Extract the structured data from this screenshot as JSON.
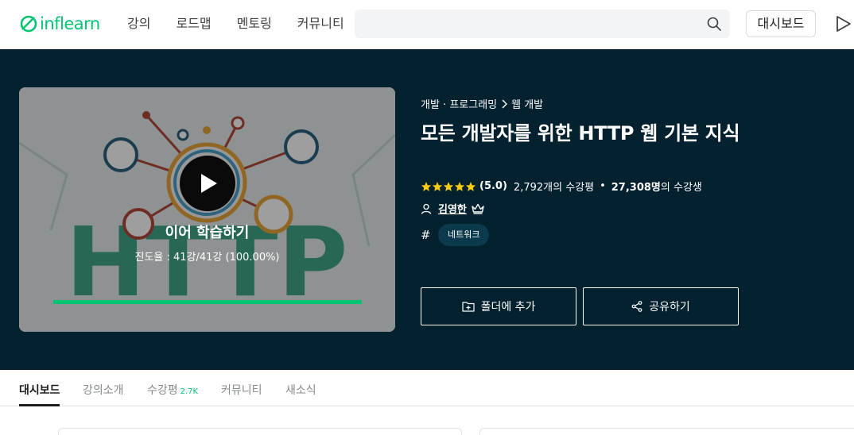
{
  "nav": {
    "logo_text": "inflearn",
    "links": [
      "강의",
      "로드맵",
      "멘토링",
      "커뮤니티"
    ],
    "search_placeholder": "",
    "dashboard_label": "대시보드",
    "brand_color": "#00c471"
  },
  "course": {
    "breadcrumb": [
      "개발 · 프로그래밍",
      "웹 개발"
    ],
    "title": "모든 개발자를 위한 HTTP 웹 기본 지식",
    "rating": "(5.0)",
    "stars": 5,
    "review_count": "2,792개의 수강평",
    "students_count": "27,308명",
    "students_suffix": "의 수강생",
    "instructor": "김영한",
    "tags": [
      "네트워크"
    ],
    "thumbnail_word": "HTTP"
  },
  "resume": {
    "title": "이어 학습하기",
    "progress_text": "진도율 : 41강/41강 (100.00%)",
    "progress_fraction": 1.0
  },
  "actions": {
    "folder_label": "폴더에 추가",
    "share_label": "공유하기"
  },
  "tabs": [
    {
      "label": "대시보드",
      "active": true
    },
    {
      "label": "강의소개"
    },
    {
      "label": "수강평",
      "count": "2.7K"
    },
    {
      "label": "커뮤니티"
    },
    {
      "label": "새소식"
    }
  ],
  "colors": {
    "hero_bg": "#04212f",
    "accent": "#00c471",
    "star": "#fdcc11",
    "tag_bg": "#0a3a4c"
  }
}
